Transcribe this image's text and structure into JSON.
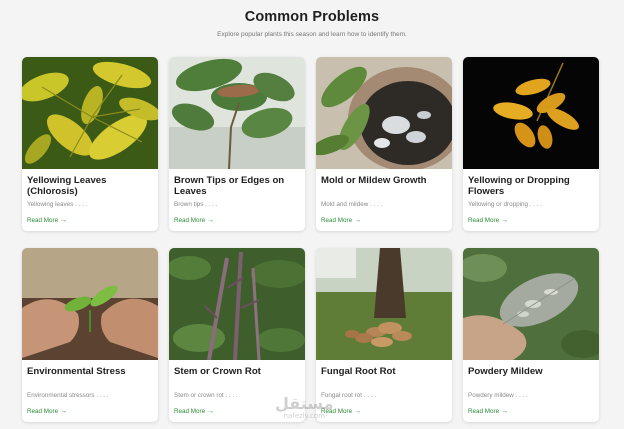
{
  "header": {
    "title": "Common Problems",
    "subtitle": "Explore popular plants this season and learn how to identify them."
  },
  "cards": [
    {
      "title": "Yellowing Leaves (Chlorosis)",
      "desc": "Yellowing leaves . . . .",
      "link": "Read More"
    },
    {
      "title": "Brown Tips or Edges on Leaves",
      "desc": "Brown tips . . . .",
      "link": "Read More"
    },
    {
      "title": "Mold or Mildew Growth",
      "desc": "Mold and mildew . . . .",
      "link": "Read More"
    },
    {
      "title": "Yellowing or Dropping Flowers",
      "desc": "Yellowing or dropping . . . .",
      "link": "Read More"
    },
    {
      "title": "Environmental Stress",
      "desc": "Environmental stressors . . . .",
      "link": "Read More"
    },
    {
      "title": "Stem or Crown Rot",
      "desc": "Stem or crown rot . . . .",
      "link": "Read More"
    },
    {
      "title": "Fungal Root Rot",
      "desc": "Fungal root rot . . . .",
      "link": "Read More"
    },
    {
      "title": "Powdery Mildew",
      "desc": "Powdery mildew . . . .",
      "link": "Read More"
    }
  ],
  "icons": {
    "read_more": "arrow-right-icon"
  },
  "colors": {
    "link": "#2e8b3a",
    "background": "#f4f4f4",
    "card": "#ffffff"
  },
  "watermark": {
    "logo": "مستقل",
    "text": "nafezly.com"
  }
}
